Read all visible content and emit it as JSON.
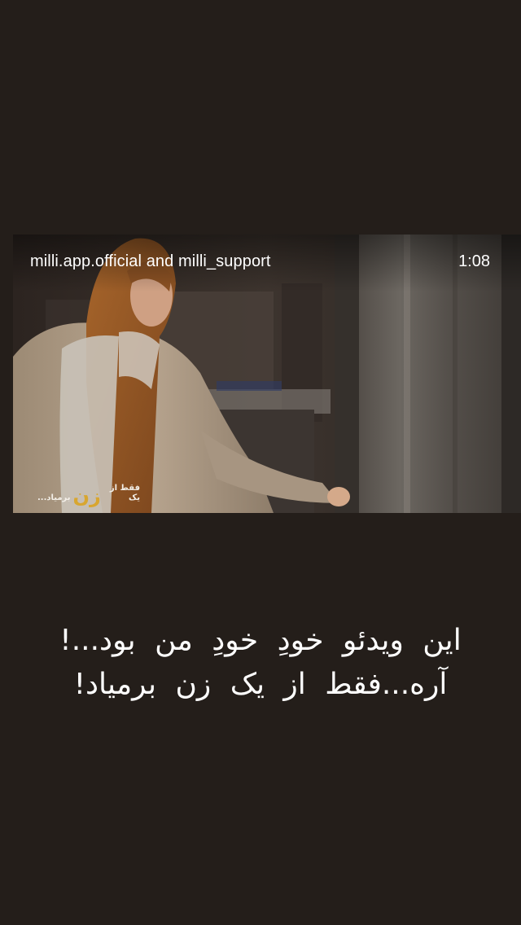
{
  "story": {
    "accounts_label": "milli.app.official and milli_support",
    "duration": "1:08",
    "video_watermark": {
      "small_prefix": "فقط از یک",
      "big_word": "زن",
      "small_suffix": "برمیاد..."
    },
    "caption": {
      "line1": "این ویدئو خودِ خودِ من بود...!",
      "line2": "آره...فقط از یک زن برمیاد!"
    }
  },
  "colors": {
    "background": "#241e1a",
    "text": "#ffffff",
    "watermark_accent": "#d8a630"
  }
}
